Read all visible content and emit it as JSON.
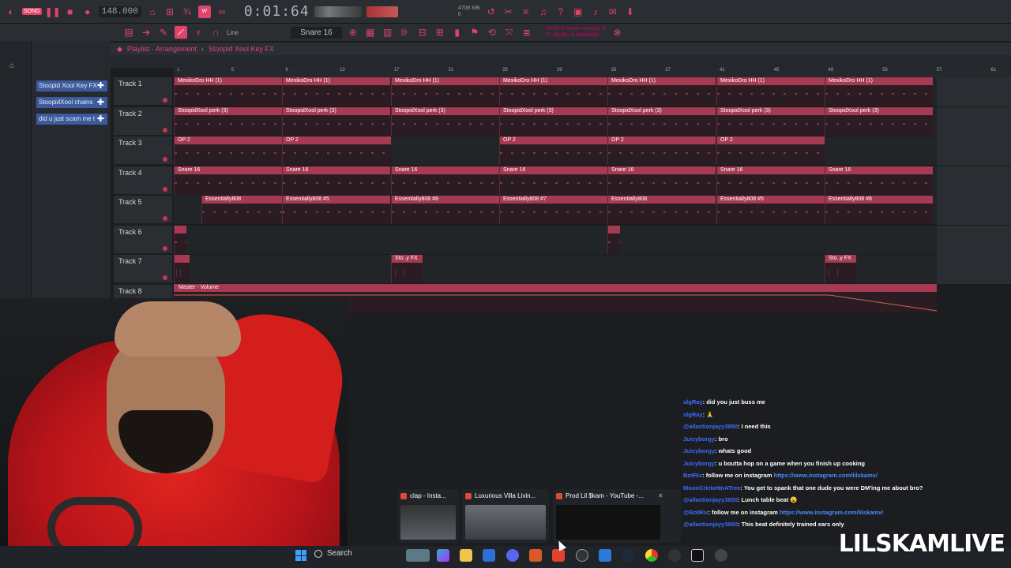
{
  "toolbar": {
    "tempo": "148.000",
    "time": "0:01:64",
    "cpu_line1": "4708 MB",
    "cpu_line2": "0",
    "pattern": "Snare 16",
    "snap": "Line",
    "notice_line1": "04:23  A newer version of",
    "notice_line2": "FL Studio is available!"
  },
  "picker": {
    "items": [
      "Stoopid Xool Key FX",
      "StoopidXool chains",
      "did u just scam me t"
    ]
  },
  "playlist": {
    "title": "Playlist - Arrangement",
    "separator": "›",
    "pattern": "Stoopid Xool Key FX"
  },
  "ruler": [
    "1",
    "5",
    "9",
    "13",
    "17",
    "21",
    "25",
    "29",
    "33",
    "37",
    "41",
    "45",
    "49",
    "53",
    "57",
    "61"
  ],
  "tracks": [
    {
      "label": "Track 1",
      "clips": [
        "MexikoDro HH (1)",
        "MexikoDro HH (1)",
        "MexikoDro HH (1)",
        "MexikoDro HH (1)",
        "MexikoDro HH (1)",
        "MexikoDro HH (1)",
        "MexikoDro HH (1)"
      ]
    },
    {
      "label": "Track 2",
      "clips": [
        "StoopidXool perk (3)",
        "StoopidXool perk (3)",
        "StoopidXool perk (3)",
        "StoopidXool perk (3)",
        "StoopidXool perk (3)",
        "StoopidXool perk (3)",
        "StoopidXool perk (3)"
      ]
    },
    {
      "label": "Track 3",
      "clips": [
        "OP 2",
        "OP 2",
        "OP 2",
        "OP 2",
        "OP 2"
      ]
    },
    {
      "label": "Track 4",
      "clips": [
        "Snare 16",
        "Snare 16",
        "Snare 16",
        "Snare 16",
        "Snare 16",
        "Snare 16",
        "Snare 16"
      ]
    },
    {
      "label": "Track 5",
      "clips": [
        "Essentially808",
        "Essentially808 #5",
        "Essentially808 #8",
        "Essentially808 #7",
        "Essentially808",
        "Essentially808 #5",
        "Essentially808 #8"
      ]
    },
    {
      "label": "Track 6",
      "clips": [
        "",
        ""
      ]
    },
    {
      "label": "Track 7",
      "clips": [
        "",
        "Sto..y FX",
        "Sto..y FX"
      ]
    },
    {
      "label": "Track 8",
      "clips": []
    }
  ],
  "master": "Master - Volume",
  "chat": [
    {
      "user": "slgRay",
      "msg": ": did you just buss me"
    },
    {
      "user": "slgRay",
      "msg": ": 🙏"
    },
    {
      "user": "@allactionjayy3850",
      "msg": ": I need this"
    },
    {
      "user": "Juicyborgy",
      "msg": ": bro"
    },
    {
      "user": "Juicyborgy",
      "msg": ": whats good"
    },
    {
      "user": "Juicyborgy",
      "msg": ": u boutta hop on a game when you finish up cooking"
    },
    {
      "user": "BotRix",
      "msg": ": follow me on instagram ",
      "link": "https://www.instagram.com/lilskamx/"
    },
    {
      "user": "MoonCricketInATree",
      "msg": ": You get to spank that one dude you were DM'ing me about bro?"
    },
    {
      "user": "@allactionjayy3850",
      "msg": ": Lunch table beat 😮"
    },
    {
      "user": "@BotRix",
      "msg": ": follow me on instagram ",
      "link": "https://www.instagram.com/lilskamx/"
    },
    {
      "user": "@allactionjayy3850",
      "msg": ": This beat definitely trained ears only"
    }
  ],
  "previews": [
    {
      "title": "clap - Insta..."
    },
    {
      "title": "Luxurious Villa Livin..."
    },
    {
      "title": "Prod Lil $kam - YouTube -..."
    }
  ],
  "taskbar": {
    "search": "Search"
  },
  "watermark": "LILSKAMLIVE",
  "colors": {
    "accent": "#e0446a",
    "clip": "#a63a52",
    "picker": "#3d5a9c"
  }
}
